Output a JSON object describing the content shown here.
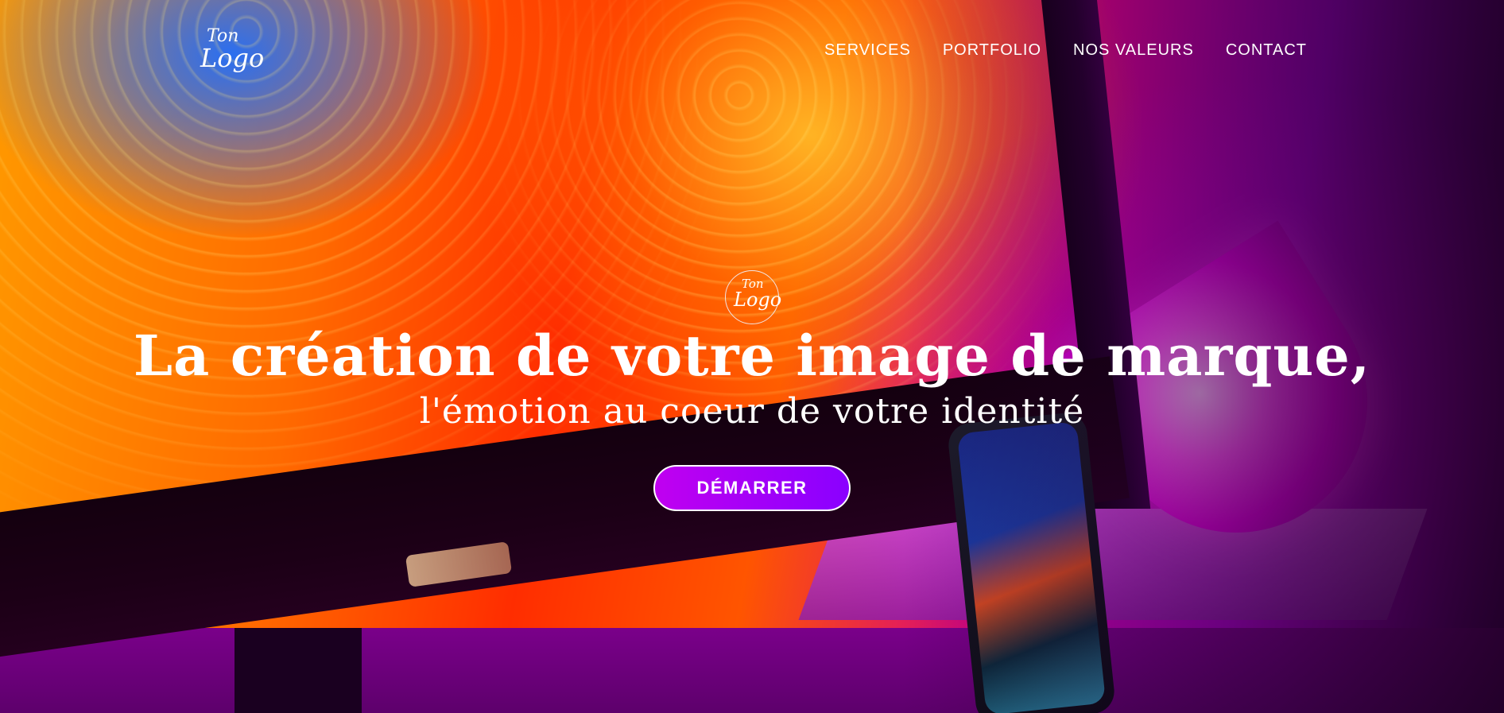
{
  "brand": {
    "logo_top": "Ton",
    "logo_bottom": "Logo"
  },
  "nav": {
    "items": [
      {
        "label": "SERVICES"
      },
      {
        "label": "PORTFOLIO"
      },
      {
        "label": "NOS VALEURS"
      },
      {
        "label": "CONTACT"
      }
    ]
  },
  "hero": {
    "emblem_top": "Ton",
    "emblem_bottom": "Logo",
    "headline": "La création de votre image de marque,",
    "subline": "l'émotion au coeur de votre identité",
    "cta_label": "DÉMARRER"
  },
  "colors": {
    "accent": "#b000f5",
    "text": "#ffffff"
  }
}
